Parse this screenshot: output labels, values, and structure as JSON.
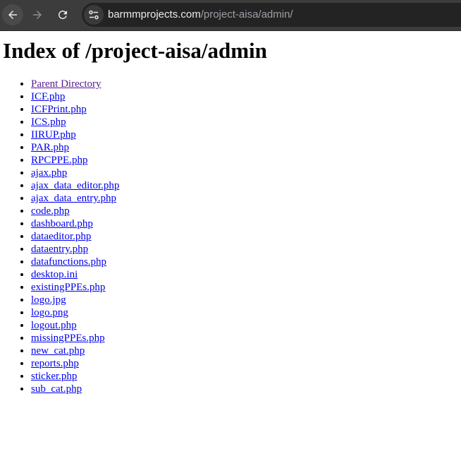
{
  "browser": {
    "url_domain": "barmmprojects.com",
    "url_path": "/project-aisa/admin/"
  },
  "page": {
    "heading": "Index of /project-aisa/admin",
    "entries": [
      {
        "label": "Parent Directory",
        "visited": true
      },
      {
        "label": "ICF.php"
      },
      {
        "label": "ICFPrint.php"
      },
      {
        "label": "ICS.php"
      },
      {
        "label": "IIRUP.php"
      },
      {
        "label": "PAR.php"
      },
      {
        "label": "RPCPPE.php"
      },
      {
        "label": "ajax.php"
      },
      {
        "label": "ajax_data_editor.php"
      },
      {
        "label": "ajax_data_entry.php"
      },
      {
        "label": "code.php"
      },
      {
        "label": "dashboard.php"
      },
      {
        "label": "dataeditor.php"
      },
      {
        "label": "dataentry.php"
      },
      {
        "label": "datafunctions.php"
      },
      {
        "label": "desktop.ini"
      },
      {
        "label": "existingPPEs.php"
      },
      {
        "label": "logo.jpg"
      },
      {
        "label": "logo.png"
      },
      {
        "label": "logout.php"
      },
      {
        "label": "missingPPEs.php"
      },
      {
        "label": "new_cat.php"
      },
      {
        "label": "reports.php"
      },
      {
        "label": "sticker.php"
      },
      {
        "label": "sub_cat.php"
      }
    ]
  },
  "colors": {
    "link": "#0000ee",
    "visited_link": "#551a8b",
    "toolbar": "#3c3c3c",
    "omnibox": "#232323"
  },
  "icons": {
    "back": "arrow-left-icon",
    "forward": "arrow-right-icon",
    "reload": "reload-icon",
    "site_info": "tune-icon"
  }
}
